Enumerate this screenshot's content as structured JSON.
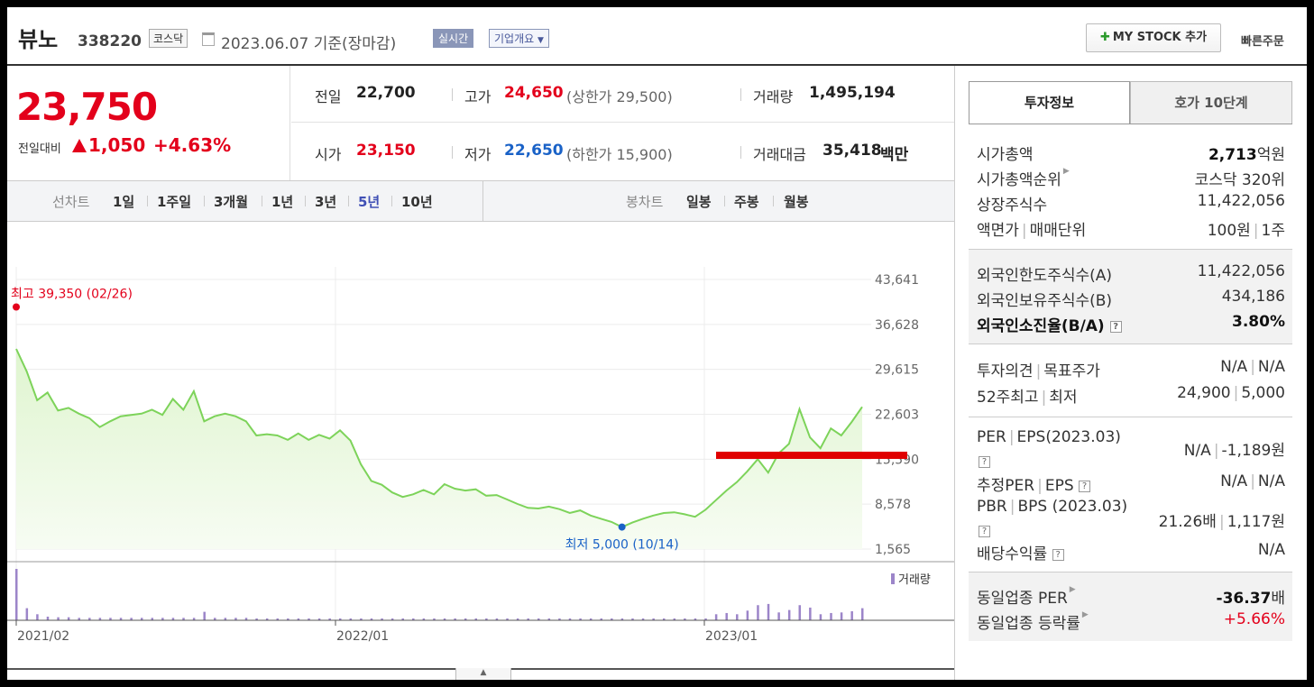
{
  "header": {
    "name": "뷰노",
    "code": "338220",
    "market": "코스닥",
    "date": "2023.06.07 기준(장마감)",
    "realtime": "실시간",
    "company_info": "기업개요",
    "mystock": "MY STOCK 추가",
    "quick_order": "빠른주문"
  },
  "price": {
    "current": "23,750",
    "change_label": "전일대비",
    "change": "1,050",
    "change_pct": "+4.63%"
  },
  "stats": {
    "prev_label": "전일",
    "prev": "22,700",
    "high_label": "고가",
    "high": "24,650",
    "upper_limit": "(상한가 29,500)",
    "volume_label": "거래량",
    "volume": "1,495,194",
    "open_label": "시가",
    "open": "23,150",
    "low_label": "저가",
    "low": "22,650",
    "lower_limit": "(하한가 15,900)",
    "value_label": "거래대금",
    "value": "35,418",
    "value_unit": "백만"
  },
  "tabs": {
    "line_chart": "선차트",
    "periods": [
      "1일",
      "1주일",
      "3개월",
      "1년",
      "3년",
      "5년",
      "10년"
    ],
    "active": "5년",
    "candle_chart": "봉차트",
    "candles": [
      "일봉",
      "주봉",
      "월봉"
    ]
  },
  "chart_data": {
    "type": "area",
    "x_tick_labels": [
      "2021/02",
      "2022/01",
      "2023/01"
    ],
    "y_tick_labels": [
      "43,641",
      "36,628",
      "29,615",
      "22,603",
      "15,590",
      "8,578",
      "1,565"
    ],
    "ylim": [
      1565,
      43641
    ],
    "high_annotation": "최고 39,350 (02/26)",
    "low_annotation": "최저 5,000 (10/14)",
    "volume_label": "거래량",
    "line_color": "#7dd35a",
    "fill_color": "#dff5cf",
    "series": [
      {
        "values": [
          32800,
          29300,
          24800,
          26000,
          23200,
          23600,
          22700,
          22000,
          20600,
          21500,
          22300,
          22500,
          22700,
          23300,
          22500,
          25000,
          23300,
          26200,
          21500,
          22300,
          22700,
          22300,
          21500,
          19300,
          19500,
          19300,
          18600,
          19600,
          18600,
          19400,
          18800,
          20100,
          18500,
          14800,
          12200,
          11600,
          10400,
          9700,
          10100,
          10800,
          10100,
          11700,
          11000,
          10700,
          10900,
          9900,
          10000,
          9300,
          8600,
          8000,
          7900,
          8200,
          7800,
          7200,
          7600,
          6800,
          6300,
          5800,
          5000,
          5700,
          6300,
          6800,
          7200,
          7300,
          7000,
          6600,
          7700,
          9200,
          10700,
          12000,
          13700,
          15600,
          13500,
          16500,
          18000,
          23400,
          19000,
          17300,
          20400,
          19300,
          21400,
          23750
        ]
      }
    ],
    "volume": [
      85,
      20,
      10,
      6,
      5,
      5,
      4,
      4,
      4,
      4,
      4,
      4,
      4,
      4,
      4,
      4,
      4,
      4,
      14,
      4,
      4,
      4,
      4,
      3,
      3,
      3,
      3,
      3,
      3,
      3,
      3,
      3,
      3,
      3,
      3,
      3,
      3,
      3,
      3,
      3,
      3,
      3,
      3,
      3,
      3,
      3,
      3,
      3,
      3,
      3,
      3,
      3,
      3,
      3,
      3,
      3,
      3,
      3,
      3,
      3,
      3,
      3,
      3,
      3,
      3,
      3,
      3,
      10,
      12,
      10,
      16,
      25,
      27,
      13,
      17,
      25,
      21,
      10,
      12,
      13,
      15,
      20
    ]
  },
  "invest": {
    "tab_on": "투자정보",
    "tab_off": "호가 10단계",
    "mcap_label": "시가총액",
    "mcap": "2,713",
    "mcap_unit": "억원",
    "mcap_rank_label": "시가총액순위",
    "mcap_rank": "코스닥 320위",
    "shares_label": "상장주식수",
    "shares": "11,422,056",
    "face_label": "액면가",
    "unit_label": "매매단위",
    "face": "100원",
    "unit": "1주",
    "foreign_limit_label": "외국인한도주식수(A)",
    "foreign_limit": "11,422,056",
    "foreign_hold_label": "외국인보유주식수(B)",
    "foreign_hold": "434,186",
    "foreign_ratio_label": "외국인소진율(B/A)",
    "foreign_ratio": "3.80%",
    "opinion_label": "투자의견",
    "target_label": "목표주가",
    "opinion": "N/A",
    "target": "N/A",
    "w52_high_label": "52주최고",
    "w52_low_label": "최저",
    "w52_high": "24,900",
    "w52_low": "5,000",
    "per_label": "PER",
    "eps_label": "EPS(2023.03)",
    "per": "N/A",
    "eps": "-1,189원",
    "est_per_label": "추정PER",
    "est_eps_label": "EPS",
    "est_per": "N/A",
    "est_eps": "N/A",
    "pbr_label": "PBR",
    "bps_label": "BPS (2023.03)",
    "pbr": "21.26배",
    "bps": "1,117원",
    "div_label": "배당수익률",
    "div": "N/A",
    "ind_per_label": "동일업종 PER",
    "ind_per": "-36.37",
    "ind_per_unit": "배",
    "ind_chg_label": "동일업종 등락률",
    "ind_chg": "+5.66%"
  },
  "colors": {
    "up": "#e3001b",
    "down": "#1a62c7",
    "accent": "#4050b5",
    "annotation_line": "#e00000"
  }
}
